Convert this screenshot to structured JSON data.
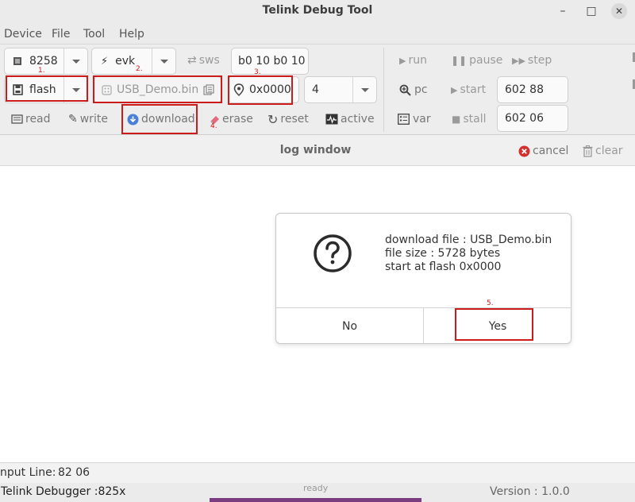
{
  "window": {
    "title": "Telink Debug Tool",
    "minimize": "–",
    "maximize": "□",
    "close": "✕"
  },
  "menu": [
    "Device",
    "File",
    "Tool",
    "Help"
  ],
  "toolbar": {
    "chip": "8258",
    "board": "evk",
    "sws_label": "sws",
    "sws_value": "b0 10 b0 10",
    "memory": "flash",
    "file": "USB_Demo.bin",
    "address": "0x0000",
    "size": "4",
    "read": "read",
    "write": "write",
    "download": "download",
    "erase": "erase",
    "reset": "reset",
    "active": "active",
    "run": "run",
    "pause": "pause",
    "step": "step",
    "pc": "pc",
    "start": "start",
    "start_value": "602 88",
    "var": "var",
    "stall": "stall",
    "stall_value": "602 06"
  },
  "annotations": [
    "1.",
    "2.",
    "3.",
    "4.",
    "5."
  ],
  "log": {
    "title": "log window",
    "cancel": "cancel",
    "clear": "clear"
  },
  "dialog": {
    "line1": "download file : USB_Demo.bin",
    "line2": "file size : 5728 bytes",
    "line3": "start at flash 0x0000",
    "no": "No",
    "yes": "Yes"
  },
  "input_line": {
    "label": "nput Line:",
    "value": "82 06"
  },
  "status": {
    "left": "Telink Debugger :825x",
    "center": "ready",
    "right": "Version : 1.0.0"
  },
  "colors": {
    "annotation_red": "#cc1b1b",
    "progress": "#7a3d80",
    "download_blue": "#4a7fd6",
    "cancel_red": "#d33030"
  }
}
